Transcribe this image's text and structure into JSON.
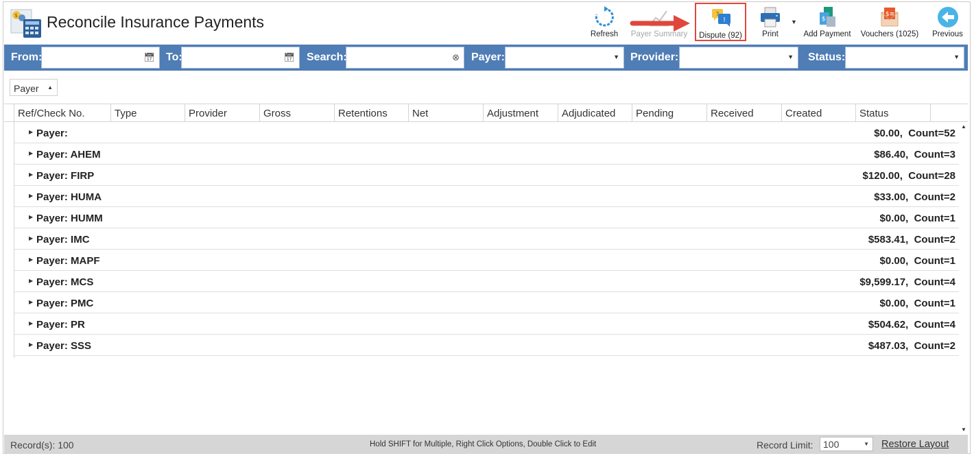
{
  "app": {
    "title": "Reconcile Insurance Payments"
  },
  "toolbar": {
    "refresh": "Refresh",
    "payer_summary": "Payer Summary",
    "dispute": "Dispute (92)",
    "print": "Print",
    "add_payment": "Add Payment",
    "vouchers": "Vouchers (1025)",
    "previous": "Previous"
  },
  "filters": {
    "from_label": "From:",
    "to_label": "To:",
    "search_label": "Search:",
    "payer_label": "Payer:",
    "provider_label": "Provider:",
    "status_label": "Status:"
  },
  "group_by": {
    "label": "Payer"
  },
  "columns": [
    "Ref/Check No.",
    "Type",
    "Provider",
    "Gross",
    "Retentions",
    "Net",
    "Adjustment",
    "Adjudicated",
    "Pending",
    "Received",
    "Created",
    "Status"
  ],
  "groups": [
    {
      "name": "Payer:",
      "summary": "$0.00,  Count=52"
    },
    {
      "name": "Payer: AHEM",
      "summary": "$86.40,  Count=3"
    },
    {
      "name": "Payer: FIRP",
      "summary": "$120.00,  Count=28"
    },
    {
      "name": "Payer: HUMA",
      "summary": "$33.00,  Count=2"
    },
    {
      "name": "Payer: HUMM",
      "summary": "$0.00,  Count=1"
    },
    {
      "name": "Payer: IMC",
      "summary": "$583.41,  Count=2"
    },
    {
      "name": "Payer: MAPF",
      "summary": "$0.00,  Count=1"
    },
    {
      "name": "Payer: MCS",
      "summary": "$9,599.17,  Count=4"
    },
    {
      "name": "Payer: PMC",
      "summary": "$0.00,  Count=1"
    },
    {
      "name": "Payer: PR",
      "summary": "$504.62,  Count=4"
    },
    {
      "name": "Payer: SSS",
      "summary": "$487.03,  Count=2"
    }
  ],
  "status_bar": {
    "records": "Record(s): 100",
    "hint": "Hold SHIFT for Multiple, Right Click Options, Double Click to Edit",
    "record_limit_label": "Record Limit:",
    "record_limit_value": "100",
    "restore_layout": "Restore Layout"
  },
  "colors": {
    "filter_bar": "#4f7db5",
    "highlight": "#e0473c",
    "status_bar": "#d6d6d6"
  }
}
